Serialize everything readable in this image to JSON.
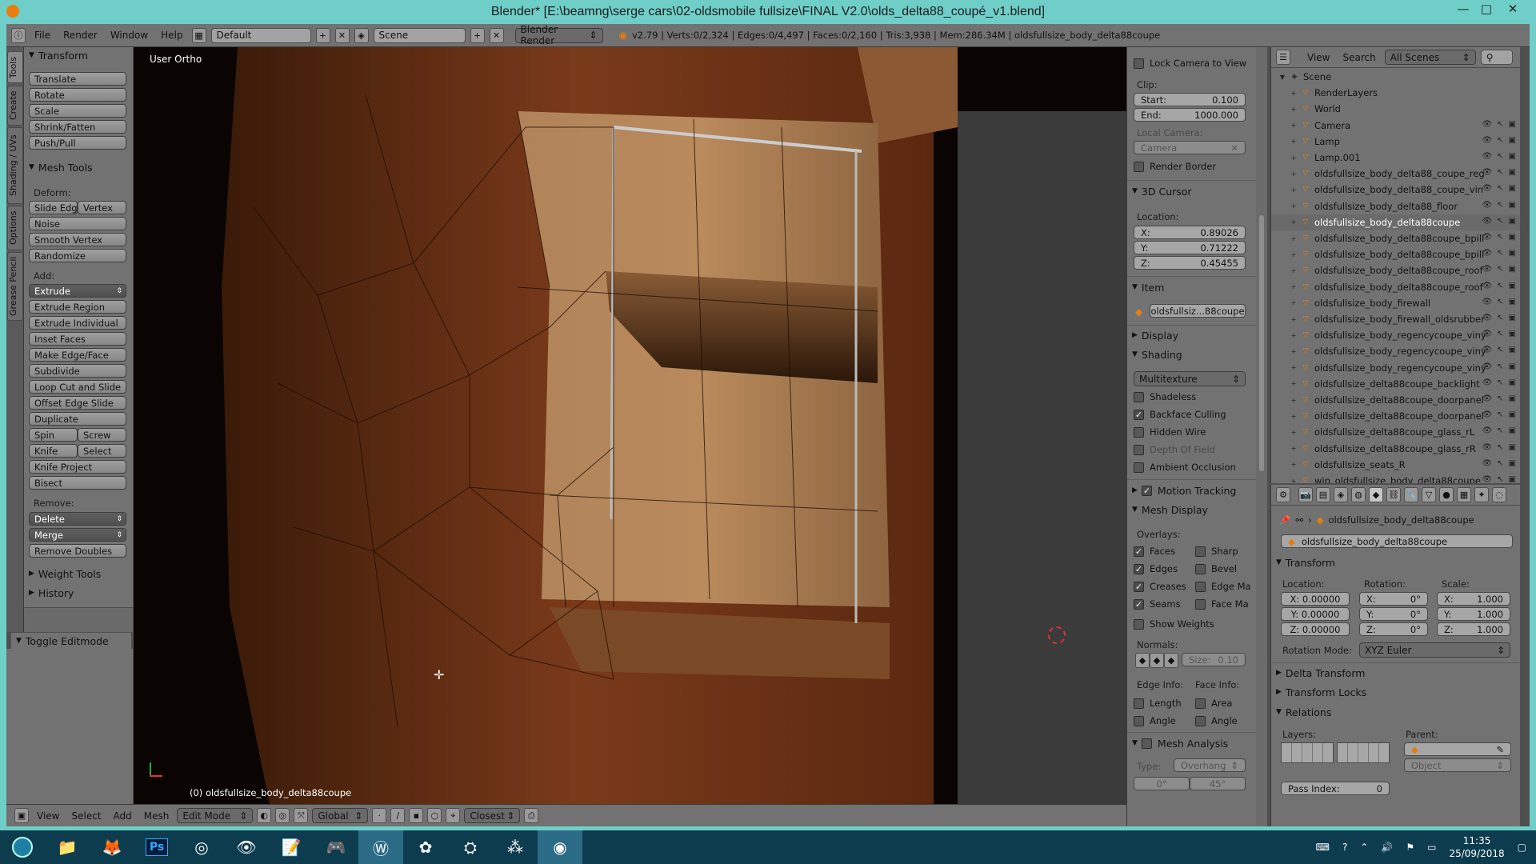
{
  "window": {
    "title": "Blender* [E:\\beamng\\serge cars\\02-oldsmobile fullsize\\FINAL V2.0\\olds_delta88_coupé_v1.blend]",
    "controls": [
      "—",
      "□",
      "✕"
    ]
  },
  "infobar": {
    "menus": [
      "File",
      "Render",
      "Window",
      "Help"
    ],
    "layout": "Default",
    "scene": "Scene",
    "engine": "Blender Render",
    "stats": "v2.79 | Verts:0/2,324 | Edges:0/4,497 | Faces:0/2,160 | Tris:3,938 | Mem:286.34M | oldsfullsize_body_delta88coupe"
  },
  "lefttabs": [
    "Tools",
    "Create",
    "Shading / UVs",
    "Options",
    "Grease Pencil"
  ],
  "toolshelf": {
    "transform_header": "Transform",
    "transform_buttons": [
      "Translate",
      "Rotate",
      "Scale",
      "Shrink/Fatten",
      "Push/Pull"
    ],
    "meshtools_header": "Mesh Tools",
    "deform_label": "Deform:",
    "slide_edge": "Slide Edge",
    "vertex": "Vertex",
    "deform_buttons": [
      "Noise",
      "Smooth Vertex",
      "Randomize"
    ],
    "add_label": "Add:",
    "extrude": "Extrude",
    "add_buttons": [
      "Extrude Region",
      "Extrude Individual",
      "Inset Faces",
      "Make Edge/Face",
      "Subdivide",
      "Loop Cut and Slide",
      "Offset Edge Slide",
      "Duplicate"
    ],
    "spin": "Spin",
    "screw": "Screw",
    "knife": "Knife",
    "select": "Select",
    "knife_project": "Knife Project",
    "bisect": "Bisect",
    "remove_label": "Remove:",
    "delete": "Delete",
    "merge": "Merge",
    "remove_doubles": "Remove Doubles",
    "weight_tools": "Weight Tools",
    "history": "History",
    "toggle_editmode": "Toggle Editmode"
  },
  "viewport": {
    "view_name": "User Ortho",
    "object_label": "(0) oldsfullsize_body_delta88coupe"
  },
  "vpheader": {
    "menus": [
      "View",
      "Select",
      "Add",
      "Mesh"
    ],
    "mode": "Edit Mode",
    "orientation": "Global",
    "snap": "Closest"
  },
  "npanel": {
    "lock_camera": "Lock Camera to View",
    "clip_label": "Clip:",
    "start_label": "Start:",
    "start_value": "0.100",
    "end_label": "End:",
    "end_value": "1000.000",
    "local_camera_label": "Local Camera:",
    "camera_placeholder": "Camera",
    "render_border": "Render Border",
    "cursor_header": "3D Cursor",
    "location_label": "Location:",
    "cursor_x": "0.89026",
    "cursor_y": "0.71222",
    "cursor_z": "0.45455",
    "item_header": "Item",
    "item_name": "oldsfullsiz...88coupe",
    "display_header": "Display",
    "shading_header": "Shading",
    "shading_mode": "Multitexture",
    "shadeless": "Shadeless",
    "backface_culling": "Backface Culling",
    "hidden_wire": "Hidden Wire",
    "depth_of_field": "Depth Of Field",
    "ambient_occlusion": "Ambient Occlusion",
    "motion_tracking": "Motion Tracking",
    "mesh_display_header": "Mesh Display",
    "overlays_label": "Overlays:",
    "faces": "Faces",
    "sharp": "Sharp",
    "edges": "Edges",
    "bevel": "Bevel",
    "creases": "Creases",
    "edge_ma": "Edge Ma",
    "seams": "Seams",
    "face_ma": "Face Ma",
    "show_weights": "Show Weights",
    "normals_label": "Normals:",
    "size_label": "Size:",
    "size_value": "0.10",
    "edge_info_label": "Edge Info:",
    "face_info_label": "Face Info:",
    "length": "Length",
    "area": "Area",
    "angle1": "Angle",
    "angle2": "Angle",
    "mesh_analysis": "Mesh Analysis",
    "type_label": "Type:",
    "type_value": "Overhang",
    "deg0": "0°",
    "deg45": "45°"
  },
  "outliner": {
    "view": "View",
    "search": "Search",
    "filter": "All Scenes",
    "rows": [
      {
        "label": "Scene",
        "indent": 0
      },
      {
        "label": "RenderLayers",
        "indent": 1
      },
      {
        "label": "World",
        "indent": 1
      },
      {
        "label": "Camera",
        "indent": 1
      },
      {
        "label": "Lamp",
        "indent": 1
      },
      {
        "label": "Lamp.001",
        "indent": 1
      },
      {
        "label": "oldsfullsize_body_delta88_coupe_reg",
        "indent": 1
      },
      {
        "label": "oldsfullsize_body_delta88_coupe_vin",
        "indent": 1
      },
      {
        "label": "oldsfullsize_body_delta88_floor",
        "indent": 1
      },
      {
        "label": "oldsfullsize_body_delta88coupe",
        "indent": 1
      },
      {
        "label": "oldsfullsize_body_delta88coupe_bpill",
        "indent": 1
      },
      {
        "label": "oldsfullsize_body_delta88coupe_bpill",
        "indent": 1
      },
      {
        "label": "oldsfullsize_body_delta88coupe_roof",
        "indent": 1
      },
      {
        "label": "oldsfullsize_body_delta88coupe_roof",
        "indent": 1
      },
      {
        "label": "oldsfullsize_body_firewall",
        "indent": 1
      },
      {
        "label": "oldsfullsize_body_firewall_oldsrubber",
        "indent": 1
      },
      {
        "label": "oldsfullsize_body_regencycoupe_viny",
        "indent": 1
      },
      {
        "label": "oldsfullsize_body_regencycoupe_viny",
        "indent": 1
      },
      {
        "label": "oldsfullsize_body_regencycoupe_viny",
        "indent": 1
      },
      {
        "label": "oldsfullsize_delta88coupe_backlight",
        "indent": 1
      },
      {
        "label": "oldsfullsize_delta88coupe_doorpanel",
        "indent": 1
      },
      {
        "label": "oldsfullsize_delta88coupe_doorpanel",
        "indent": 1
      },
      {
        "label": "oldsfullsize_delta88coupe_glass_rL",
        "indent": 1
      },
      {
        "label": "oldsfullsize_delta88coupe_glass_rR",
        "indent": 1
      },
      {
        "label": "oldsfullsize_seats_R",
        "indent": 1
      },
      {
        "label": "wip_oldsfullsize_body_delta88coupe",
        "indent": 1
      }
    ]
  },
  "properties": {
    "context_object": "oldsfullsize_body_delta88coupe",
    "name_field": "oldsfullsize_body_delta88coupe",
    "transform_header": "Transform",
    "location_label": "Location:",
    "rotation_label": "Rotation:",
    "scale_label": "Scale:",
    "loc_x": "X: 0.00000",
    "loc_y": "Y: 0.00000",
    "loc_z": "Z: 0.00000",
    "rot_x": "X:",
    "rot_y": "Y:",
    "rot_z": "Z:",
    "rot_val": "0°",
    "scale_x": "X:",
    "scale_y": "Y:",
    "scale_z": "Z:",
    "scale_val": "1.000",
    "rotation_mode_label": "Rotation Mode:",
    "rotation_mode": "XYZ Euler",
    "delta_transform": "Delta Transform",
    "transform_locks": "Transform Locks",
    "relations": "Relations",
    "layers_label": "Layers:",
    "parent_label": "Parent:",
    "parent_type": "Object",
    "pass_index_label": "Pass Index:",
    "pass_index": "0"
  },
  "taskbar": {
    "clock_time": "11:35",
    "clock_date": "25/09/2018"
  }
}
